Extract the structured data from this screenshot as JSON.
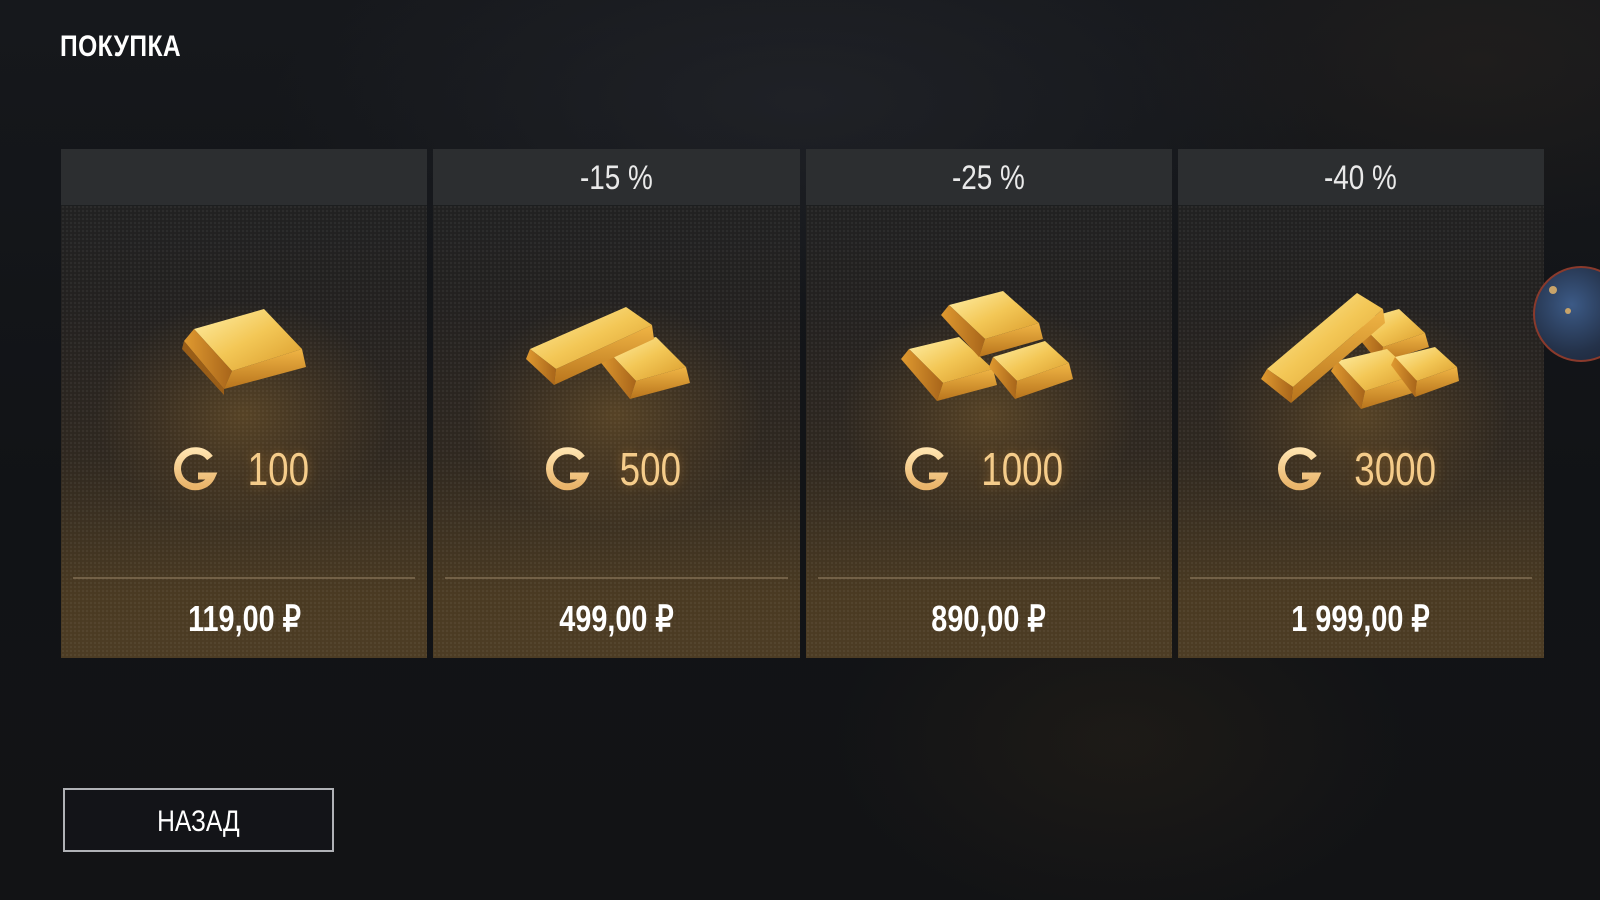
{
  "page": {
    "title": "ПОКУПКА"
  },
  "offers": [
    {
      "discount": "",
      "amount": "100",
      "price": "119,00 ₽",
      "image": "gold-bar-single"
    },
    {
      "discount": "-15 %",
      "amount": "500",
      "price": "499,00 ₽",
      "image": "gold-bars-two"
    },
    {
      "discount": "-25 %",
      "amount": "1000",
      "price": "890,00 ₽",
      "image": "gold-bars-stack-three"
    },
    {
      "discount": "-40 %",
      "amount": "3000",
      "price": "1 999,00 ₽",
      "image": "gold-bars-pile"
    }
  ],
  "currency_icon": "gold-coin-icon",
  "footer": {
    "back_label": "НАЗАД"
  },
  "colors": {
    "background": "#15171a",
    "card_header": "#2c2e30",
    "amount_text": "#f5cc8a",
    "price_text": "#ffffff",
    "gold": "#e2a93c"
  }
}
